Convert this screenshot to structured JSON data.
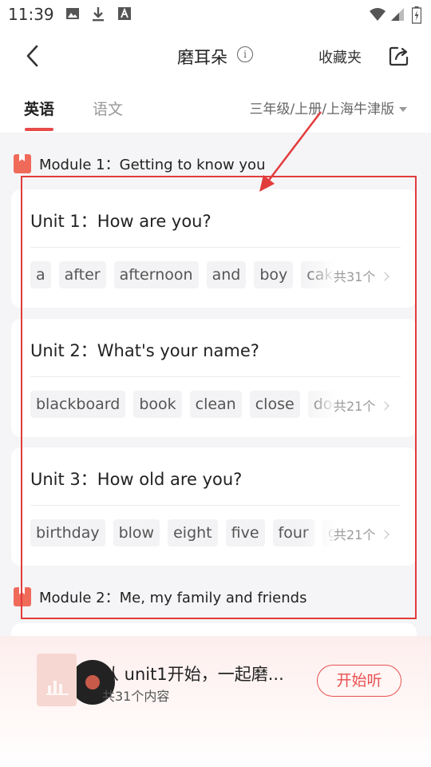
{
  "status_bar": {
    "time": "11:39"
  },
  "header": {
    "title": "磨耳朵",
    "favorites_label": "收藏夹"
  },
  "tabs": [
    {
      "label": "英语"
    },
    {
      "label": "语文"
    }
  ],
  "grade_selector": {
    "label": "三年级/上册/上海牛津版"
  },
  "modules": [
    {
      "title": "Module 1：Getting to know you",
      "units": [
        {
          "title": "Unit 1：How are you?",
          "words": [
            "a",
            "after",
            "afternoon",
            "and",
            "boy",
            "cake"
          ],
          "count": "共31个"
        },
        {
          "title": "Unit 2：What's your name?",
          "words": [
            "blackboard",
            "book",
            "clean",
            "close",
            "door"
          ],
          "count": "共21个"
        },
        {
          "title": "Unit 3：How old are you?",
          "words": [
            "birthday",
            "blow",
            "eight",
            "five",
            "four",
            "gu"
          ],
          "count": "共21个"
        }
      ]
    },
    {
      "title": "Module 2：Me, my family and friends"
    }
  ],
  "player": {
    "title": "从 unit1开始，一起磨...",
    "subtitle": "共31个内容",
    "button": "开始听"
  },
  "colors": {
    "accent": "#e84a4a",
    "annotation": "#e23b3b"
  },
  "icons": [
    "back-arrow-icon",
    "info-icon",
    "share-icon",
    "bookmark-icon",
    "chevron-right-icon",
    "vinyl-disc-icon"
  ]
}
